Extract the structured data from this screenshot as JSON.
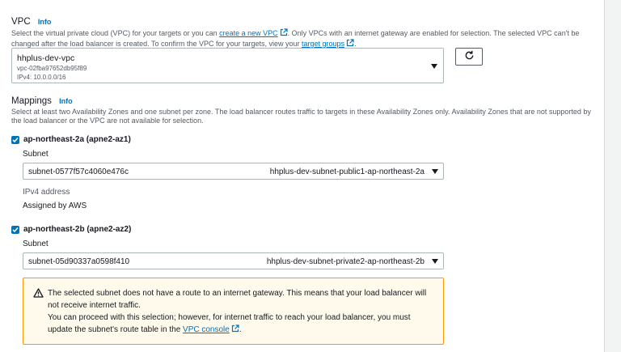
{
  "vpc": {
    "label": "VPC",
    "info": "Info",
    "desc_part1": "Select the virtual private cloud (VPC) for your targets or you can ",
    "create_link": "create a new VPC",
    "desc_part2": ". Only VPCs with an internet gateway are enabled for selection. The selected VPC can't be changed after the load balancer is created. To confirm the VPC for your targets, view your ",
    "target_groups_link": "target groups",
    "desc_part3": ".",
    "selected": {
      "name": "hhplus-dev-vpc",
      "id": "vpc-02fba97652db95f89",
      "cidr": "IPv4: 10.0.0.0/16"
    }
  },
  "mappings": {
    "label": "Mappings",
    "info": "Info",
    "desc": "Select at least two Availability Zones and one subnet per zone. The load balancer routes traffic to targets in these Availability Zones only. Availability Zones that are not supported by the load balancer or the VPC are not available for selection.",
    "zones": [
      {
        "name": "ap-northeast-2a (apne2-az1)",
        "checked": true,
        "subnet_label": "Subnet",
        "subnet_id": "subnet-0577f57c4060e476c",
        "subnet_name": "hhplus-dev-subnet-public1-ap-northeast-2a",
        "ipv4_label": "IPv4 address",
        "ipv4_value": "Assigned by AWS"
      },
      {
        "name": "ap-northeast-2b (apne2-az2)",
        "checked": true,
        "subnet_label": "Subnet",
        "subnet_id": "subnet-05d90337a0598f410",
        "subnet_name": "hhplus-dev-subnet-private2-ap-northeast-2b"
      }
    ]
  },
  "warning": {
    "line1": "The selected subnet does not have a route to an internet gateway. This means that your load balancer will",
    "line2": "not receive internet traffic.",
    "line3": "You can proceed with this selection; however, for internet traffic to reach your load balancer, you must",
    "line4_prefix": "update the subnet's route table in the ",
    "vpc_console_link": "VPC console",
    "line4_suffix": "."
  },
  "colors": {
    "link": "#0073bb",
    "warning_bg": "#fffaeb",
    "warning_border": "#ff9900"
  },
  "icons": [
    "external-link-icon",
    "refresh-icon",
    "caret-down-icon",
    "checkmark-icon",
    "warning-icon"
  ]
}
